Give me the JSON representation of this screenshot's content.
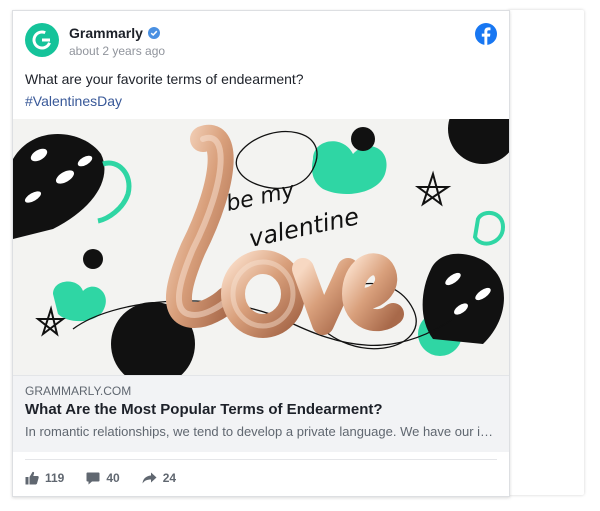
{
  "post": {
    "author": "Grammarly",
    "timestamp": "about 2 years ago",
    "text": "What are your favorite terms of endearment?",
    "hashtag": "#ValentinesDay"
  },
  "image": {
    "balloon_word": "love",
    "handwritten_text_line1": "be my",
    "handwritten_text_line2": "valentine"
  },
  "link_preview": {
    "domain": "GRAMMARLY.COM",
    "title": "What Are the Most Popular Terms of Endearment?",
    "description": "In romantic relationships, we tend to develop a private language. We have our insi…"
  },
  "engagement": {
    "likes": "119",
    "comments": "40",
    "shares": "24"
  },
  "colors": {
    "brand_green": "#15c39a",
    "facebook_blue": "#1877f2",
    "hashtag_blue": "#385898",
    "verified_blue": "#4a90e2"
  },
  "icons": [
    "grammarly-logo-icon",
    "verified-badge-icon",
    "facebook-icon",
    "like-icon",
    "comment-icon",
    "share-icon"
  ]
}
